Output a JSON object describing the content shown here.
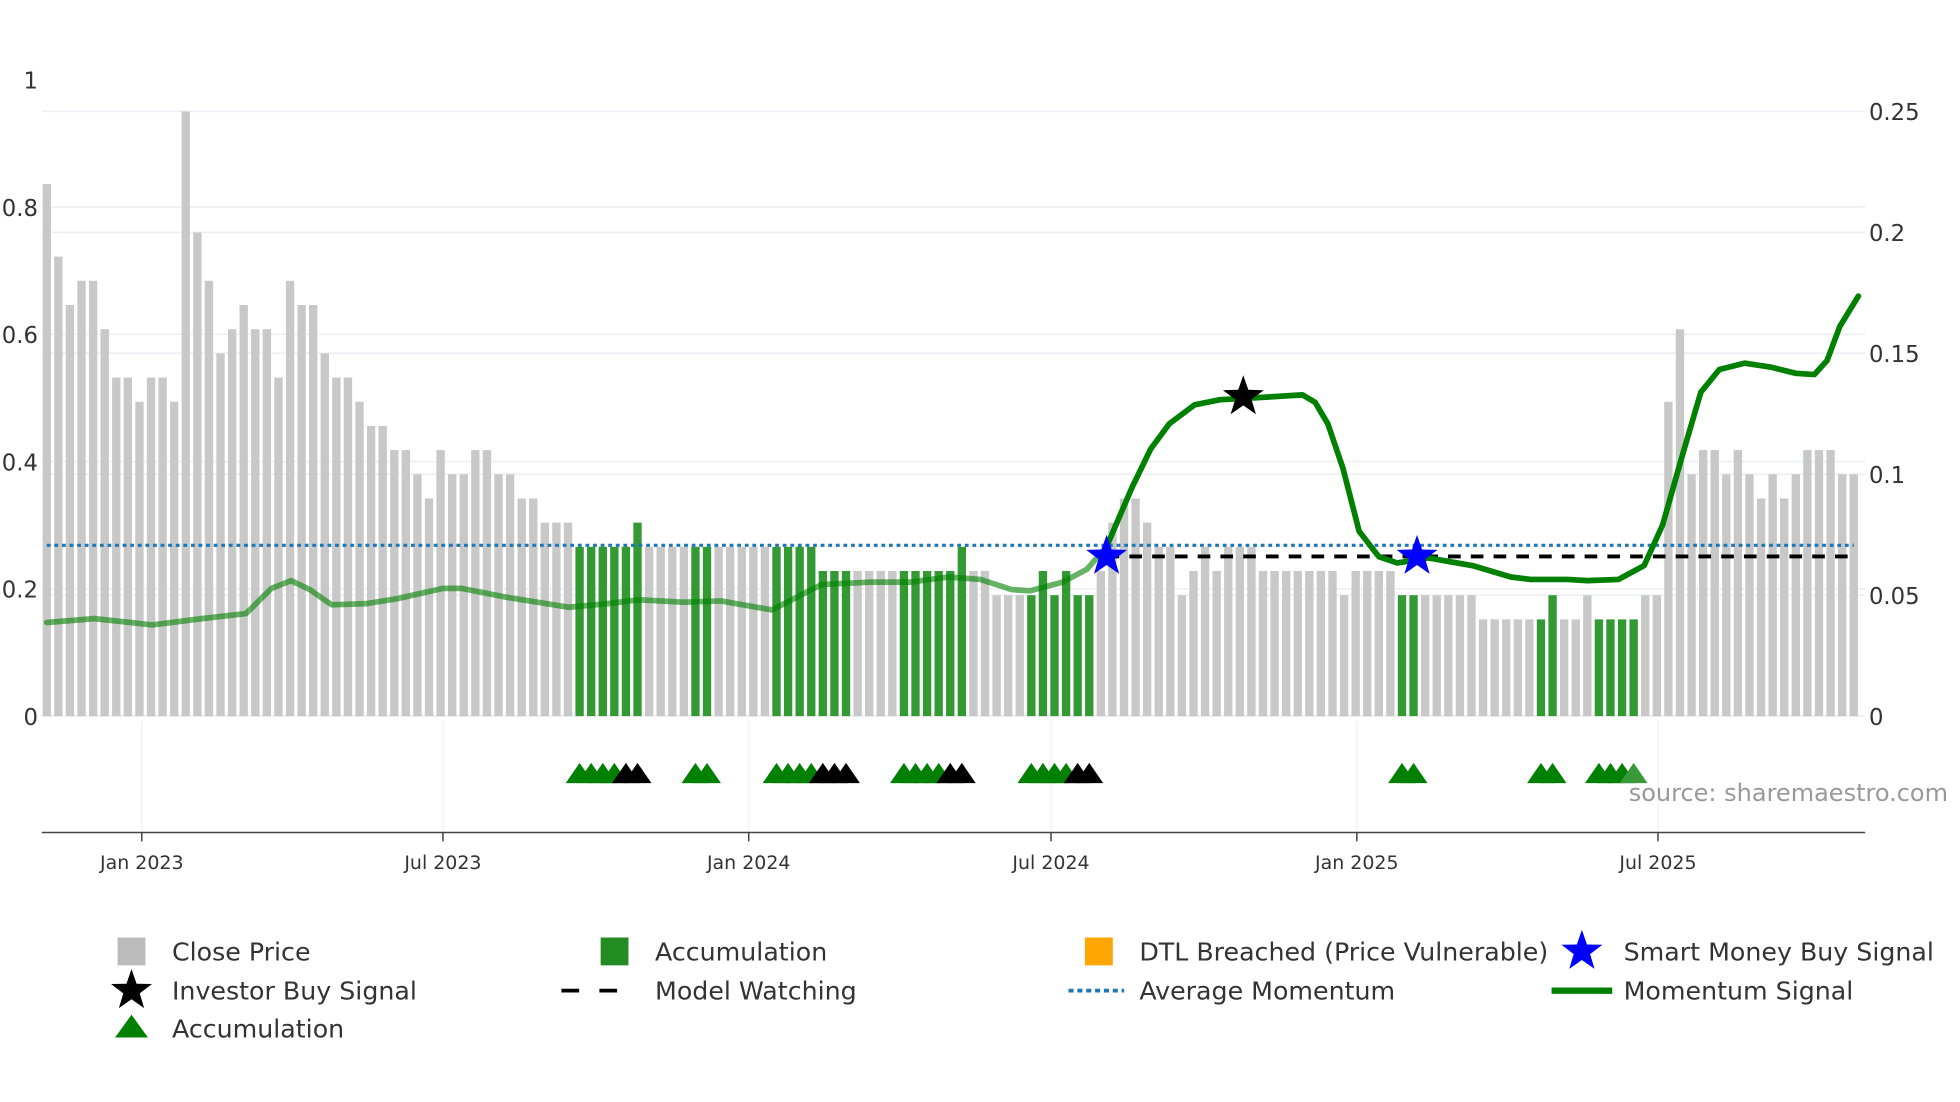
{
  "chart_data": {
    "type": "bar",
    "title": "",
    "frequency": "weekly",
    "left_axis": {
      "ticks": [
        "0",
        "0.2",
        "0.4",
        "0.6",
        "0.8",
        "1"
      ],
      "tick_values": [
        0,
        0.2,
        0.4,
        0.6,
        0.8,
        1
      ],
      "ylim": [
        0,
        1
      ]
    },
    "right_axis": {
      "ticks": [
        "0",
        "0.05",
        "0.1",
        "0.15",
        "0.2",
        "0.25"
      ],
      "tick_values": [
        0,
        0.05,
        0.1,
        0.15,
        0.2,
        0.25
      ],
      "ylim": [
        0,
        0.25
      ]
    },
    "x_ticks": [
      {
        "label": "Jan 2023",
        "week": 8.2
      },
      {
        "label": "Jul 2023",
        "week": 34.2
      },
      {
        "label": "Jan 2024",
        "week": 60.6
      },
      {
        "label": "Jul 2024",
        "week": 86.7
      },
      {
        "label": "Jan 2025",
        "week": 113.1
      },
      {
        "label": "Jul 2025",
        "week": 139.1
      }
    ],
    "close_price": [
      0.836,
      0.722,
      0.646,
      0.684,
      0.684,
      0.608,
      0.532,
      0.532,
      0.494,
      0.532,
      0.532,
      0.494,
      0.95,
      0.76,
      0.684,
      0.57,
      0.608,
      0.646,
      0.608,
      0.608,
      0.532,
      0.684,
      0.646,
      0.646,
      0.57,
      0.532,
      0.532,
      0.494,
      0.456,
      0.456,
      0.418,
      0.418,
      0.38,
      0.342,
      0.418,
      0.38,
      0.38,
      0.418,
      0.418,
      0.38,
      0.38,
      0.342,
      0.342,
      0.304,
      0.304,
      0.304,
      0.266,
      0.266,
      0.266,
      0.266,
      0.266,
      0.304,
      0.266,
      0.266,
      0.266,
      0.266,
      0.266,
      0.266,
      0.266,
      0.266,
      0.266,
      0.266,
      0.266,
      0.266,
      0.266,
      0.266,
      0.266,
      0.228,
      0.228,
      0.228,
      0.228,
      0.228,
      0.228,
      0.228,
      0.228,
      0.228,
      0.228,
      0.228,
      0.228,
      0.266,
      0.228,
      0.228,
      0.19,
      0.19,
      0.19,
      0.19,
      0.228,
      0.19,
      0.228,
      0.19,
      0.19,
      0.228,
      0.304,
      0.342,
      0.342,
      0.304,
      0.266,
      0.266,
      0.19,
      0.228,
      0.266,
      0.228,
      0.266,
      0.266,
      0.266,
      0.228,
      0.228,
      0.228,
      0.228,
      0.228,
      0.228,
      0.228,
      0.19,
      0.228,
      0.228,
      0.228,
      0.228,
      0.19,
      0.19,
      0.19,
      0.19,
      0.19,
      0.19,
      0.19,
      0.152,
      0.152,
      0.152,
      0.152,
      0.152,
      0.152,
      0.19,
      0.152,
      0.152,
      0.19,
      0.152,
      0.152,
      0.152,
      0.152,
      0.19,
      0.19,
      0.494,
      0.608,
      0.38,
      0.418,
      0.418,
      0.38,
      0.418,
      0.38,
      0.342,
      0.38,
      0.342,
      0.38,
      0.418,
      0.418,
      0.418,
      0.38,
      0.38
    ],
    "accumulation_bars": [
      46,
      47,
      48,
      49,
      50,
      51,
      56,
      57,
      63,
      64,
      65,
      66,
      67,
      68,
      69,
      74,
      75,
      76,
      77,
      78,
      79,
      85,
      86,
      87,
      88,
      89,
      90,
      117,
      118,
      129,
      130,
      134,
      135,
      136,
      137
    ],
    "momentum_signal": [
      [
        0,
        0.0387
      ],
      [
        4.1,
        0.0403
      ],
      [
        9.1,
        0.0377
      ],
      [
        13.4,
        0.0403
      ],
      [
        17.2,
        0.0424
      ],
      [
        19.4,
        0.0528
      ],
      [
        21.1,
        0.056
      ],
      [
        22.7,
        0.0523
      ],
      [
        24.6,
        0.046
      ],
      [
        27.6,
        0.0465
      ],
      [
        30.3,
        0.0486
      ],
      [
        34.2,
        0.0528
      ],
      [
        35.8,
        0.0528
      ],
      [
        39.6,
        0.0492
      ],
      [
        45.1,
        0.045
      ],
      [
        48.4,
        0.0465
      ],
      [
        51.1,
        0.0481
      ],
      [
        54.9,
        0.0471
      ],
      [
        58.2,
        0.0476
      ],
      [
        62.6,
        0.0439
      ],
      [
        66.9,
        0.0544
      ],
      [
        71.3,
        0.0554
      ],
      [
        74.6,
        0.0554
      ],
      [
        77.8,
        0.0575
      ],
      [
        80.6,
        0.0565
      ],
      [
        83.3,
        0.0523
      ],
      [
        84.9,
        0.0518
      ],
      [
        87.7,
        0.0554
      ],
      [
        89.8,
        0.0607
      ],
      [
        91.5,
        0.0701
      ],
      [
        93.7,
        0.0946
      ],
      [
        95.3,
        0.1104
      ],
      [
        96.9,
        0.1208
      ],
      [
        99.1,
        0.1287
      ],
      [
        101.3,
        0.1308
      ],
      [
        105.1,
        0.1318
      ],
      [
        108.4,
        0.1328
      ],
      [
        109.5,
        0.1297
      ],
      [
        110.6,
        0.1208
      ],
      [
        111.9,
        0.1025
      ],
      [
        113.3,
        0.0764
      ],
      [
        115,
        0.0659
      ],
      [
        116.6,
        0.0633
      ],
      [
        119.3,
        0.0654
      ],
      [
        123.1,
        0.0622
      ],
      [
        126.4,
        0.0575
      ],
      [
        128.1,
        0.0565
      ],
      [
        131.3,
        0.0565
      ],
      [
        133,
        0.056
      ],
      [
        135.7,
        0.0565
      ],
      [
        137.9,
        0.0622
      ],
      [
        139.5,
        0.079
      ],
      [
        141.2,
        0.1077
      ],
      [
        142.8,
        0.1339
      ],
      [
        144.4,
        0.1433
      ],
      [
        146.6,
        0.1459
      ],
      [
        148.8,
        0.1443
      ],
      [
        151,
        0.1417
      ],
      [
        152.6,
        0.1412
      ],
      [
        153.7,
        0.147
      ],
      [
        154.8,
        0.1611
      ],
      [
        156.4,
        0.1736
      ]
    ],
    "momentum_faded_until_week": 91.5,
    "average_momentum": 0.0706,
    "model_watching": {
      "value": 0.066,
      "from_week": 91.5,
      "to_week": 156
    },
    "smart_money_buy_signals": [
      [
        91.5,
        0.066
      ],
      [
        118.3,
        0.066
      ]
    ],
    "investor_buy_signals": [
      [
        103.3,
        0.132
      ]
    ],
    "triangle_markers": [
      {
        "week": 46,
        "color": "green"
      },
      {
        "week": 47,
        "color": "green"
      },
      {
        "week": 48,
        "color": "green"
      },
      {
        "week": 49,
        "color": "green"
      },
      {
        "week": 50,
        "color": "black"
      },
      {
        "week": 51,
        "color": "black"
      },
      {
        "week": 56,
        "color": "green"
      },
      {
        "week": 57,
        "color": "green"
      },
      {
        "week": 63,
        "color": "green"
      },
      {
        "week": 64,
        "color": "green"
      },
      {
        "week": 65,
        "color": "green"
      },
      {
        "week": 66,
        "color": "green"
      },
      {
        "week": 67,
        "color": "black"
      },
      {
        "week": 68,
        "color": "black"
      },
      {
        "week": 69,
        "color": "black"
      },
      {
        "week": 74,
        "color": "green"
      },
      {
        "week": 75,
        "color": "green"
      },
      {
        "week": 76,
        "color": "green"
      },
      {
        "week": 77,
        "color": "green"
      },
      {
        "week": 78,
        "color": "black"
      },
      {
        "week": 79,
        "color": "black"
      },
      {
        "week": 85,
        "color": "green"
      },
      {
        "week": 86,
        "color": "green"
      },
      {
        "week": 87,
        "color": "green"
      },
      {
        "week": 88,
        "color": "green"
      },
      {
        "week": 89,
        "color": "black"
      },
      {
        "week": 90,
        "color": "black"
      },
      {
        "week": 117,
        "color": "green"
      },
      {
        "week": 118,
        "color": "green"
      },
      {
        "week": 129,
        "color": "green"
      },
      {
        "week": 130,
        "color": "green"
      },
      {
        "week": 134,
        "color": "green"
      },
      {
        "week": 135,
        "color": "green"
      },
      {
        "week": 136,
        "color": "green"
      },
      {
        "week": 137,
        "color": "lightgreen"
      }
    ],
    "legend": [
      {
        "label": "Close Price",
        "icon": "square",
        "color": "#bbbbbb"
      },
      {
        "label": "Accumulation",
        "icon": "square",
        "color": "#228b22"
      },
      {
        "label": "DTL Breached (Price Vulnerable)",
        "icon": "square",
        "color": "#ffa500"
      },
      {
        "label": "Smart Money Buy Signal",
        "icon": "star",
        "color": "#0000ff"
      },
      {
        "label": "Investor Buy Signal",
        "icon": "star",
        "color": "#000000"
      },
      {
        "label": "Model Watching",
        "icon": "dash",
        "color": "#000000"
      },
      {
        "label": "Average Momentum",
        "icon": "dot",
        "color": "#1f77b4"
      },
      {
        "label": "Momentum Signal",
        "icon": "line",
        "color": "#008000"
      },
      {
        "label": "Accumulation",
        "icon": "triangle",
        "color": "#008000"
      }
    ],
    "legend_placement": "bottom",
    "grid": true
  },
  "watermark": "source: sharemaestro.com",
  "colors": {
    "bar": "#c8c8c8",
    "accum": "#339933",
    "momentum": "#008000",
    "avg": "#1f77b4",
    "star_blue": "#0000ff"
  }
}
